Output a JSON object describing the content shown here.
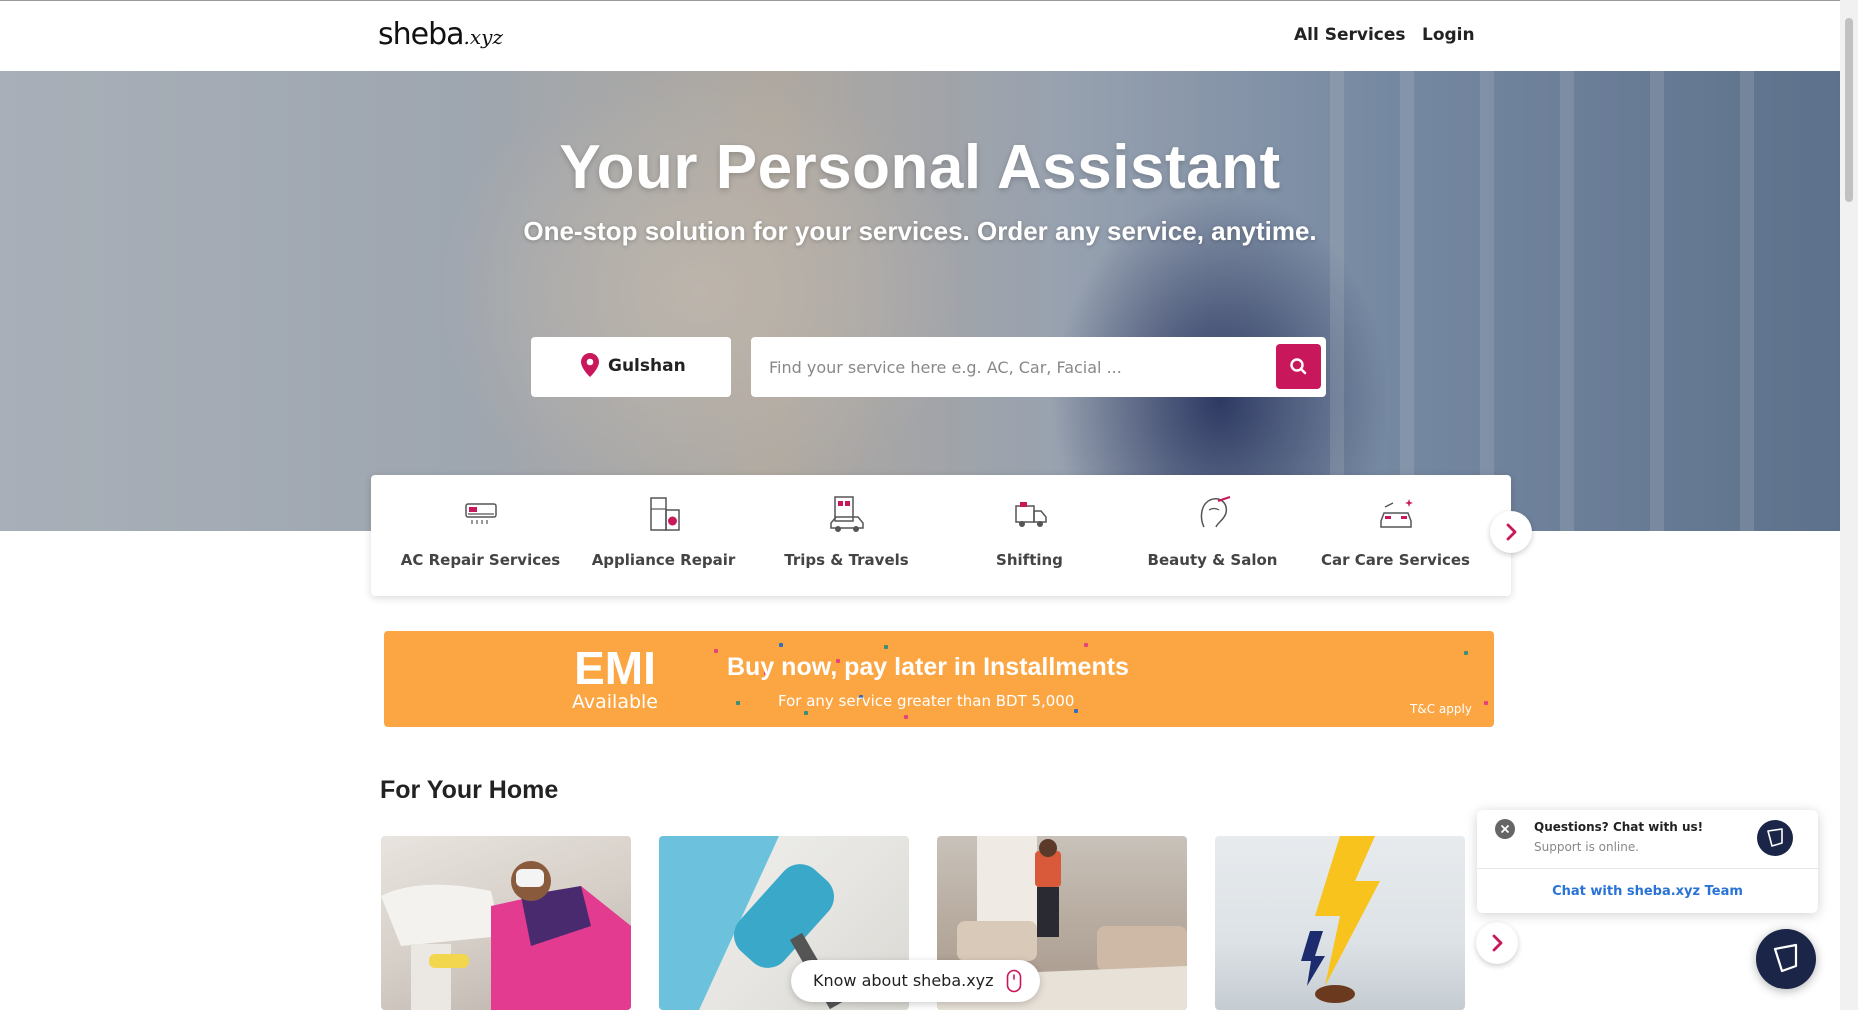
{
  "header": {
    "logo_main": "sheba",
    "logo_tld": ".xyz",
    "nav_all_services": "All Services",
    "nav_login": "Login"
  },
  "hero": {
    "title": "Your Personal Assistant",
    "subtitle": "One-stop solution for your services. Order any service, anytime.",
    "location": "Gulshan",
    "search_placeholder": "Find your service here e.g. AC, Car, Facial ...",
    "location_icon": "map-pin-icon",
    "search_icon": "search-icon"
  },
  "categories": [
    {
      "label": "AC Repair Services",
      "icon": "ac-unit-icon"
    },
    {
      "label": "Appliance Repair",
      "icon": "appliance-icon"
    },
    {
      "label": "Trips & Travels",
      "icon": "travel-luggage-icon"
    },
    {
      "label": "Shifting",
      "icon": "moving-truck-icon"
    },
    {
      "label": "Beauty & Salon",
      "icon": "beauty-face-icon"
    },
    {
      "label": "Car Care Services",
      "icon": "car-wash-icon"
    }
  ],
  "emi_banner": {
    "big": "EMI",
    "available": "Available",
    "headline": "Buy now, pay later in Installments",
    "sub": "For any service greater than BDT 5,000",
    "percent": "%",
    "tc": "T&C apply"
  },
  "home_section": {
    "title": "For Your Home"
  },
  "know_pill": {
    "label": "Know about sheba.xyz"
  },
  "chat": {
    "question": "Questions? Chat with us!",
    "status": "Support is online.",
    "link": "Chat with sheba.xyz Team"
  },
  "colors": {
    "brand": "#c9175b",
    "emi_orange": "#fca543",
    "chat_navy": "#1b2547",
    "link_blue": "#2a73d6"
  }
}
